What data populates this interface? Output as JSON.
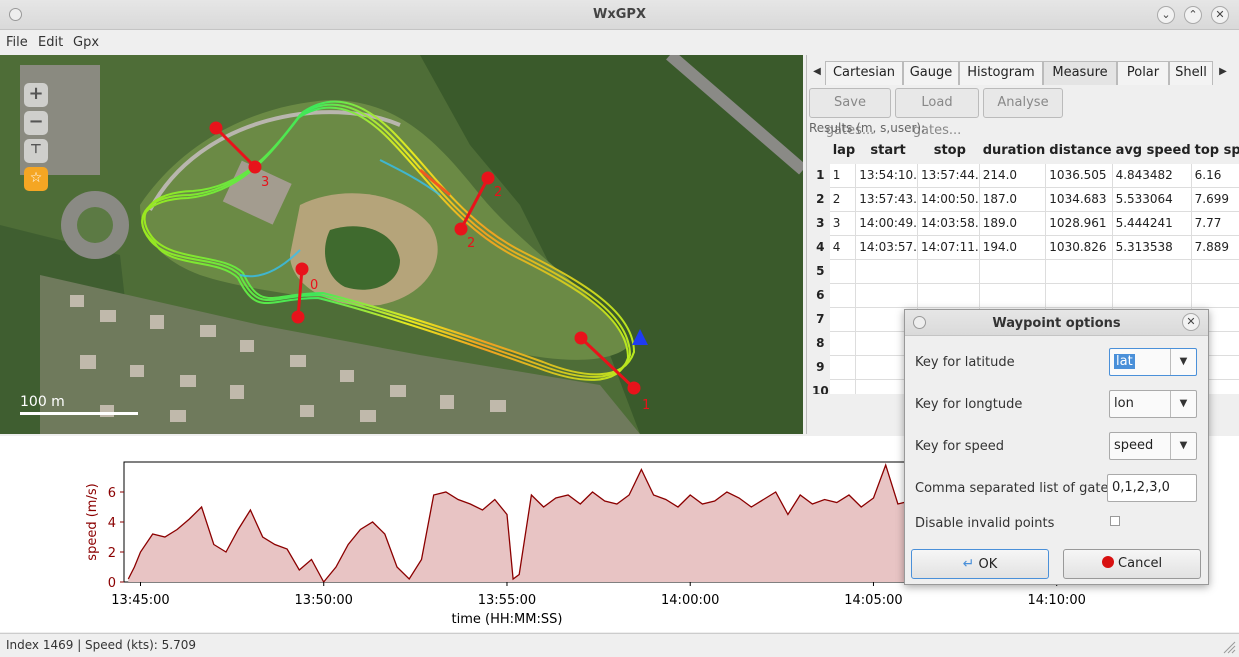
{
  "window": {
    "title": "WxGPX"
  },
  "menu": [
    "File",
    "Edit",
    "Gpx"
  ],
  "map": {
    "scale_label": "100 m",
    "gate_labels": [
      "0",
      "1",
      "2",
      "3",
      "2"
    ]
  },
  "tabs": [
    "Cartesian",
    "Gauge",
    "Histogram",
    "Measure",
    "Polar",
    "Shell"
  ],
  "toolbar": {
    "save": "Save gates...",
    "load": "Load gates...",
    "analyse": "Analyse"
  },
  "results": {
    "label": "Results (m, s,user):",
    "columns": [
      "lap",
      "start",
      "stop",
      "duration",
      "distance",
      "avg speed",
      "top speed"
    ],
    "rows": [
      {
        "num": "1",
        "cells": [
          "1",
          "13:54:10.",
          "13:57:44.",
          "214.0",
          "1036.505",
          "4.843482",
          "6.16"
        ]
      },
      {
        "num": "2",
        "cells": [
          "2",
          "13:57:43.",
          "14:00:50.",
          "187.0",
          "1034.683",
          "5.533064",
          "7.699"
        ]
      },
      {
        "num": "3",
        "cells": [
          "3",
          "14:00:49.",
          "14:03:58.",
          "189.0",
          "1028.961",
          "5.444241",
          "7.77"
        ]
      },
      {
        "num": "4",
        "cells": [
          "4",
          "14:03:57.",
          "14:07:11.",
          "194.0",
          "1030.826",
          "5.313538",
          "7.889"
        ]
      },
      {
        "num": "5",
        "cells": [
          "",
          "",
          "",
          "",
          "",
          "",
          ""
        ]
      },
      {
        "num": "6",
        "cells": [
          "",
          "",
          "",
          "",
          "",
          "",
          ""
        ]
      },
      {
        "num": "7",
        "cells": [
          "",
          "",
          "",
          "",
          "",
          "",
          ""
        ]
      },
      {
        "num": "8",
        "cells": [
          "",
          "",
          "",
          "",
          "",
          "",
          ""
        ]
      },
      {
        "num": "9",
        "cells": [
          "",
          "",
          "",
          "",
          "",
          "",
          ""
        ]
      },
      {
        "num": "10",
        "cells": [
          "",
          "",
          "",
          "",
          "",
          "",
          ""
        ]
      }
    ]
  },
  "chart_data": {
    "type": "area",
    "xlabel": "time (HH:MM:SS)",
    "ylabel": "speed (m/s)",
    "ylim": [
      0,
      8
    ],
    "yticks": [
      "0",
      "2",
      "4",
      "6"
    ],
    "xticks": [
      "13:45:00",
      "13:50:00",
      "13:55:00",
      "14:00:00",
      "14:05:00",
      "14:10:00"
    ],
    "x": [
      "13:44:40",
      "13:44:50",
      "13:45:00",
      "13:45:20",
      "13:45:40",
      "13:46:00",
      "13:46:20",
      "13:46:40",
      "13:47:00",
      "13:47:20",
      "13:47:40",
      "13:48:00",
      "13:48:20",
      "13:48:40",
      "13:49:00",
      "13:49:20",
      "13:49:40",
      "13:50:00",
      "13:50:20",
      "13:50:40",
      "13:51:00",
      "13:51:20",
      "13:51:40",
      "13:52:00",
      "13:52:20",
      "13:52:40",
      "13:53:00",
      "13:53:20",
      "13:53:40",
      "13:54:00",
      "13:54:20",
      "13:54:40",
      "13:55:00",
      "13:55:10",
      "13:55:20",
      "13:55:40",
      "13:56:00",
      "13:56:20",
      "13:56:40",
      "13:57:00",
      "13:57:20",
      "13:57:40",
      "13:58:00",
      "13:58:20",
      "13:58:40",
      "13:59:00",
      "13:59:20",
      "13:59:40",
      "14:00:00",
      "14:00:20",
      "14:00:40",
      "14:01:00",
      "14:01:20",
      "14:01:40",
      "14:02:00",
      "14:02:20",
      "14:02:40",
      "14:03:00",
      "14:03:20",
      "14:03:40",
      "14:04:00",
      "14:04:20",
      "14:04:40",
      "14:05:00",
      "14:05:20",
      "14:05:40",
      "14:06:00",
      "14:06:20",
      "14:06:40",
      "14:07:00",
      "14:07:20",
      "14:07:40",
      "14:08:00"
    ],
    "values": [
      0.2,
      1.0,
      2.0,
      3.2,
      3.0,
      3.5,
      4.2,
      5.0,
      2.5,
      2.0,
      3.5,
      4.8,
      3.0,
      2.5,
      2.2,
      0.8,
      1.5,
      0.0,
      1.0,
      2.5,
      3.5,
      4.0,
      3.2,
      1.0,
      0.2,
      1.5,
      5.8,
      6.0,
      5.5,
      5.2,
      4.8,
      5.5,
      4.5,
      0.2,
      0.5,
      5.8,
      5.0,
      5.6,
      5.8,
      5.2,
      6.0,
      5.4,
      5.2,
      5.8,
      7.5,
      5.8,
      5.5,
      5.0,
      5.8,
      5.2,
      5.4,
      6.0,
      5.6,
      5.0,
      5.5,
      6.0,
      4.5,
      5.8,
      5.2,
      5.5,
      5.3,
      5.8,
      5.0,
      5.6,
      7.8,
      5.2,
      5.4,
      5.0,
      5.2,
      4.8,
      5.0,
      5.0,
      5.2
    ]
  },
  "status": "Index 1469 | Speed (kts): 5.709",
  "dialog": {
    "title": "Waypoint options",
    "fields": [
      {
        "label": "Key for latitude",
        "value": "lat"
      },
      {
        "label": "Key for longtude",
        "value": "lon"
      },
      {
        "label": "Key for speed",
        "value": "speed"
      }
    ],
    "gates_label": "Comma separated list of gates",
    "gates_value": "0,1,2,3,0",
    "disable_label": "Disable invalid points",
    "ok": "OK",
    "cancel": "Cancel"
  },
  "colors": {
    "chart_line": "#8b0000",
    "chart_fill": "#e8c4c4",
    "gate": "#e8131b"
  }
}
